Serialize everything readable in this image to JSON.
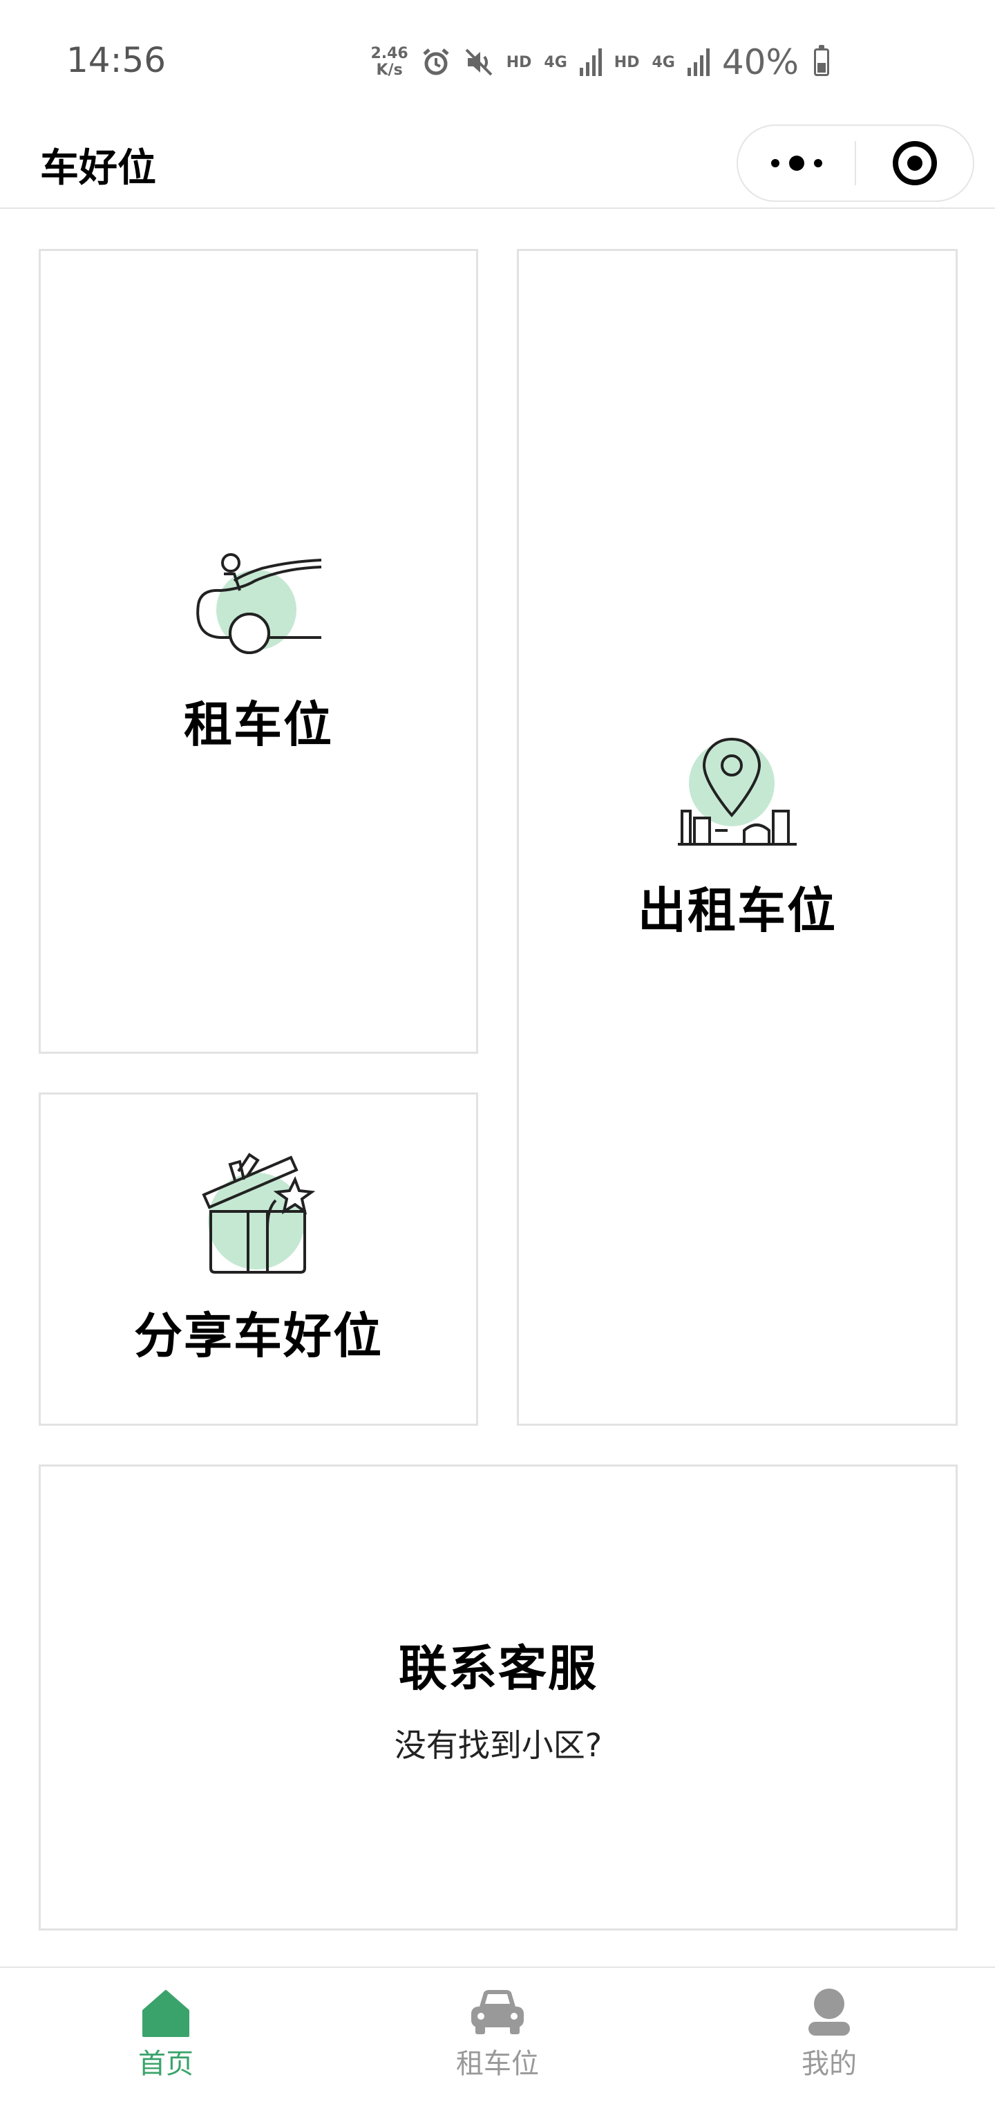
{
  "status_bar": {
    "time": "14:56",
    "net_speed_value": "2.46",
    "net_speed_unit": "K/s",
    "hd_1": "HD",
    "sig_1": "4G",
    "hd_2": "HD",
    "sig_2": "4G",
    "battery": "40%",
    "battery_level_fraction": 0.4
  },
  "nav": {
    "title": "车好位"
  },
  "cards": {
    "rent": {
      "title": "租车位"
    },
    "lease": {
      "title": "出租车位"
    },
    "share": {
      "title": "分享车好位"
    },
    "contact": {
      "title": "联系客服",
      "subtitle": "没有找到小区?"
    }
  },
  "tabbar": {
    "items": [
      {
        "label": "首页",
        "icon": "home-icon",
        "active": true
      },
      {
        "label": "租车位",
        "icon": "car-icon",
        "active": false
      },
      {
        "label": "我的",
        "icon": "user-icon",
        "active": false
      }
    ]
  },
  "colors": {
    "accent": "#3aa36b",
    "illustration_fill": "#c5e8d3",
    "inactive": "#999999"
  }
}
